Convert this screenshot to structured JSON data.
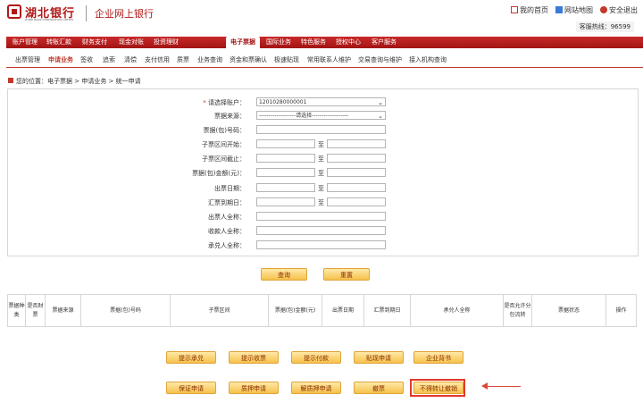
{
  "header": {
    "logo_cn": "湖北银行",
    "logo_en": "HUBEI BANK CORPORATION LIMITED",
    "title": "企业网上银行",
    "links": [
      "我的首页",
      "网站地图",
      "安全退出"
    ],
    "hotline": "客服热线：96599"
  },
  "mainnav": [
    "账户管理",
    "转账汇款",
    "财务支付",
    "现金对账",
    "投资理财",
    "电子票据",
    "国际业务",
    "特色服务",
    "授权中心",
    "客户服务"
  ],
  "subnav": [
    "出票管理",
    "申请业务",
    "签收",
    "追索",
    "清偿",
    "支付信用",
    "质票",
    "业务查询",
    "资金和票确认",
    "极速贴现",
    "常用联系人维护",
    "交易查询与维护",
    "接入机构查询"
  ],
  "breadcrumb": "您的位置：电子票据 > 申请业务 > 统一申请",
  "form": {
    "account_label": "请选择账户：",
    "account_value": "12010280000001",
    "source_label": "票据来源：",
    "source_value": "-------------------请选择-------------------",
    "bill_no_label": "票据(包)号码：",
    "sub_start_label": "子票区间开始：",
    "sub_end_label": "子票区间截止：",
    "amount_label": "票据(包)金额(元)：",
    "issue_date_label": "出票日期：",
    "due_date_label": "汇票到期日：",
    "drawer_label": "出票人全称：",
    "payee_label": "收款人全称：",
    "acceptor_label": "承兑人全称：",
    "to_label": "至"
  },
  "buttons": {
    "query": "查询",
    "reset": "重置"
  },
  "grid_headers": [
    "票据种类",
    "是否财票",
    "票据来源",
    "票据(包)号码",
    "子票区间",
    "票据(包)金额(元)",
    "出票日期",
    "汇票到期日",
    "承兑人全称",
    "是否允许分包流转",
    "票据状态",
    "操作"
  ],
  "actions_row1": [
    "提示承兑",
    "提示收票",
    "提示付款",
    "贴现申请",
    "企业背书"
  ],
  "actions_row2": [
    "保证申请",
    "质押申请",
    "解质押申请",
    "撤票",
    "不得转让撤销"
  ],
  "colors": {
    "brand": "#b01818",
    "nav_bg": "#c82a2a",
    "button": "#f5c14a",
    "highlight": "#e23a2a"
  }
}
